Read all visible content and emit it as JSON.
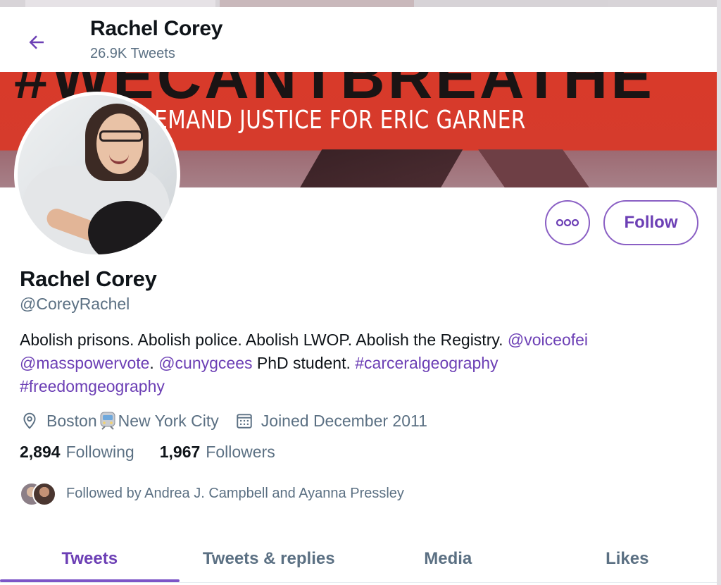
{
  "header": {
    "name": "Rachel Corey",
    "tweet_count": "26.9K Tweets"
  },
  "banner": {
    "headline": "#WECANTBREATHE",
    "tagline": "DEMAND JUSTICE FOR ERIC GARNER"
  },
  "profile": {
    "name": "Rachel Corey",
    "handle": "@CoreyRachel",
    "follow_label": "Follow",
    "bio": {
      "text1": "Abolish prisons. Abolish police. Abolish LWOP. Abolish the Registry. ",
      "link1": "@voiceofei",
      "link2": "@masspowervote",
      "text2": ". ",
      "link3": "@cunygcees",
      "text3": " PhD student. ",
      "link4": "#carceralgeography",
      "link5": "#freedomgeography"
    },
    "location_from": "Boston",
    "location_to": "New York City",
    "joined": "Joined December 2011",
    "following_count": "2,894",
    "following_label": "Following",
    "followers_count": "1,967",
    "followers_label": "Followers",
    "followed_by": "Followed by Andrea J. Campbell and Ayanna Pressley"
  },
  "tabs": [
    {
      "label": "Tweets",
      "active": true
    },
    {
      "label": "Tweets & replies",
      "active": false
    },
    {
      "label": "Media",
      "active": false
    },
    {
      "label": "Likes",
      "active": false
    }
  ],
  "colors": {
    "accent": "#6c3fb5",
    "secondary_text": "#5b7083",
    "primary_text": "#0f1419",
    "banner_red": "#d83a2a"
  },
  "icons": [
    "back-arrow-icon",
    "more-icon",
    "location-icon",
    "train-icon",
    "calendar-icon"
  ]
}
